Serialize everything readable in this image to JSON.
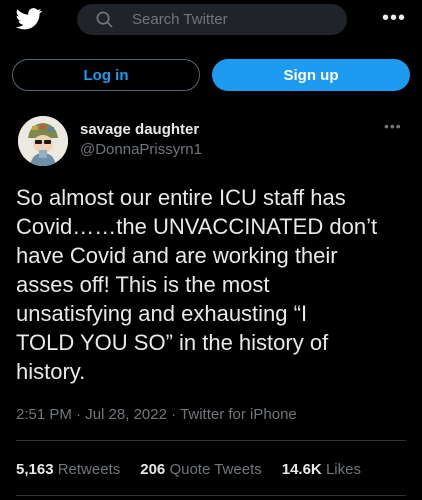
{
  "header": {
    "logo_icon": "twitter-bird-icon",
    "search_placeholder": "Search Twitter",
    "more_icon": "more-horizontal-icon"
  },
  "auth": {
    "login_label": "Log in",
    "signup_label": "Sign up"
  },
  "tweet": {
    "author_name": "savage daughter",
    "author_handle": "@DonnaPrissyrn1",
    "text": "So almost our entire ICU staff has\nCovid……the UNVACCINATED don’t\nhave Covid and are working their\nasses off!   This is the most\nunsatisfying and exhausting “I\nTOLD YOU SO” in the history of\nhistory.",
    "time": "2:51 PM",
    "date": "Jul 28, 2022",
    "source": "Twitter for iPhone",
    "retweets_count": "5,163",
    "retweets_label": "Retweets",
    "quotes_count": "206",
    "quotes_label": "Quote Tweets",
    "likes_count": "14.6K",
    "likes_label": "Likes"
  },
  "colors": {
    "accent": "#1d9bf0",
    "background": "#000000",
    "muted": "#71767b"
  }
}
